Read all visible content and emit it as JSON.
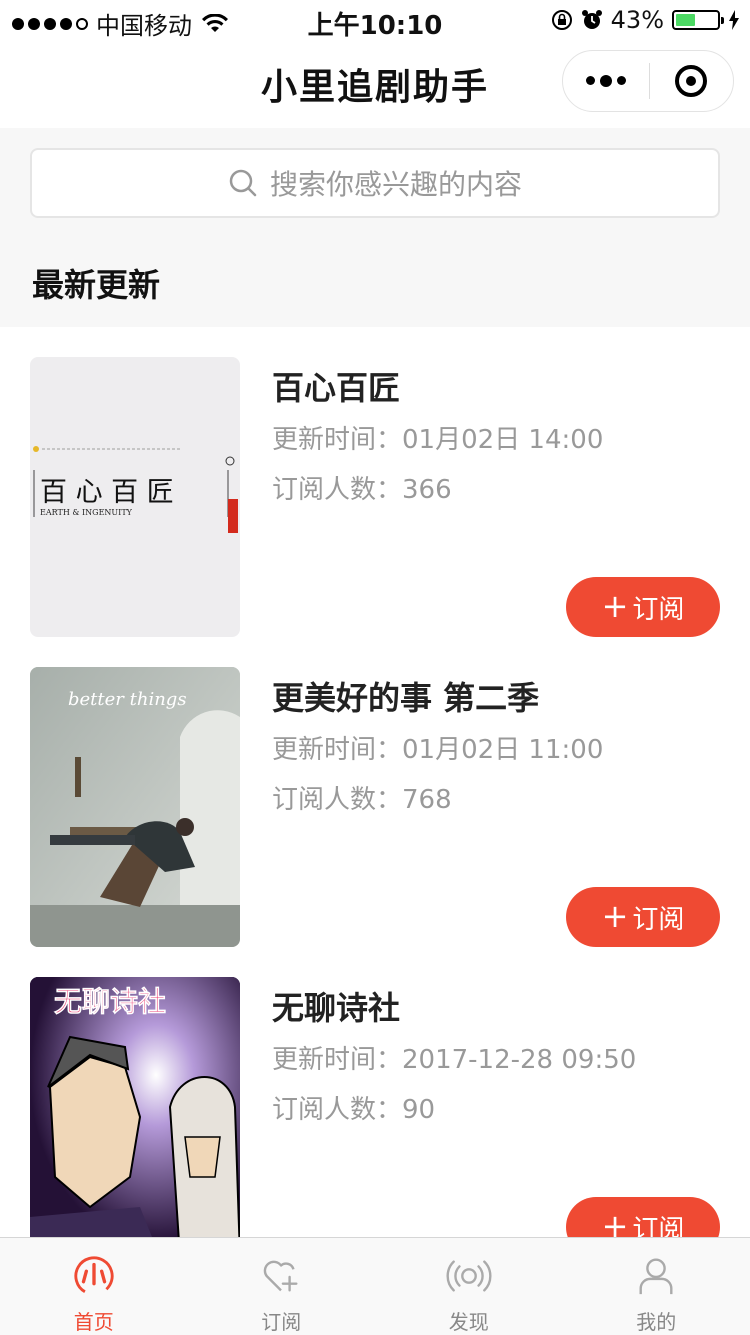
{
  "status_bar": {
    "carrier": "中国移动",
    "time": "上午10:10",
    "battery": "43%",
    "battery_level": 0.43
  },
  "nav": {
    "title": "小里追剧助手"
  },
  "search": {
    "placeholder": "搜索你感兴趣的内容"
  },
  "section": {
    "title": "最新更新"
  },
  "items": [
    {
      "title": "百心百匠",
      "update_time": "更新时间：01月02日 14:00",
      "subscribers": "订阅人数：366",
      "subscribe_label": "订阅",
      "poster": {
        "text": "百 心 百 匠",
        "subtitle": "EARTH & INGENUITY"
      }
    },
    {
      "title": "更美好的事 第二季",
      "update_time": "更新时间：01月02日 11:00",
      "subscribers": "订阅人数：768",
      "subscribe_label": "订阅",
      "poster": {
        "text": "better things"
      }
    },
    {
      "title": "无聊诗社",
      "update_time": "更新时间：2017-12-28 09:50",
      "subscribers": "订阅人数：90",
      "subscribe_label": "订阅",
      "poster": {
        "text": "无聊诗社"
      }
    }
  ],
  "tabbar": [
    {
      "label": "首页",
      "icon": "home-icon",
      "active": true
    },
    {
      "label": "订阅",
      "icon": "heart-plus-icon",
      "active": false
    },
    {
      "label": "发现",
      "icon": "broadcast-icon",
      "active": false
    },
    {
      "label": "我的",
      "icon": "user-icon",
      "active": false
    }
  ],
  "colors": {
    "accent": "#ef4a33",
    "background_gray": "#f7f7f7"
  }
}
